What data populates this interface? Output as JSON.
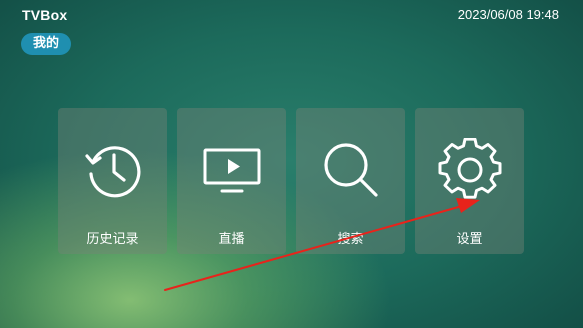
{
  "app": {
    "title": "TVBox"
  },
  "status": {
    "datetime": "2023/06/08 19:48"
  },
  "profile": {
    "label": "我的"
  },
  "tiles": [
    {
      "label": "历史记录",
      "icon": "history-clock-icon"
    },
    {
      "label": "直播",
      "icon": "live-tv-icon"
    },
    {
      "label": "搜索",
      "icon": "search-icon"
    },
    {
      "label": "设置",
      "icon": "gear-icon"
    }
  ],
  "colors": {
    "chip": "#1f8fb0",
    "arrow": "#e8231b",
    "tile": "rgba(120,130,120,0.42)"
  }
}
